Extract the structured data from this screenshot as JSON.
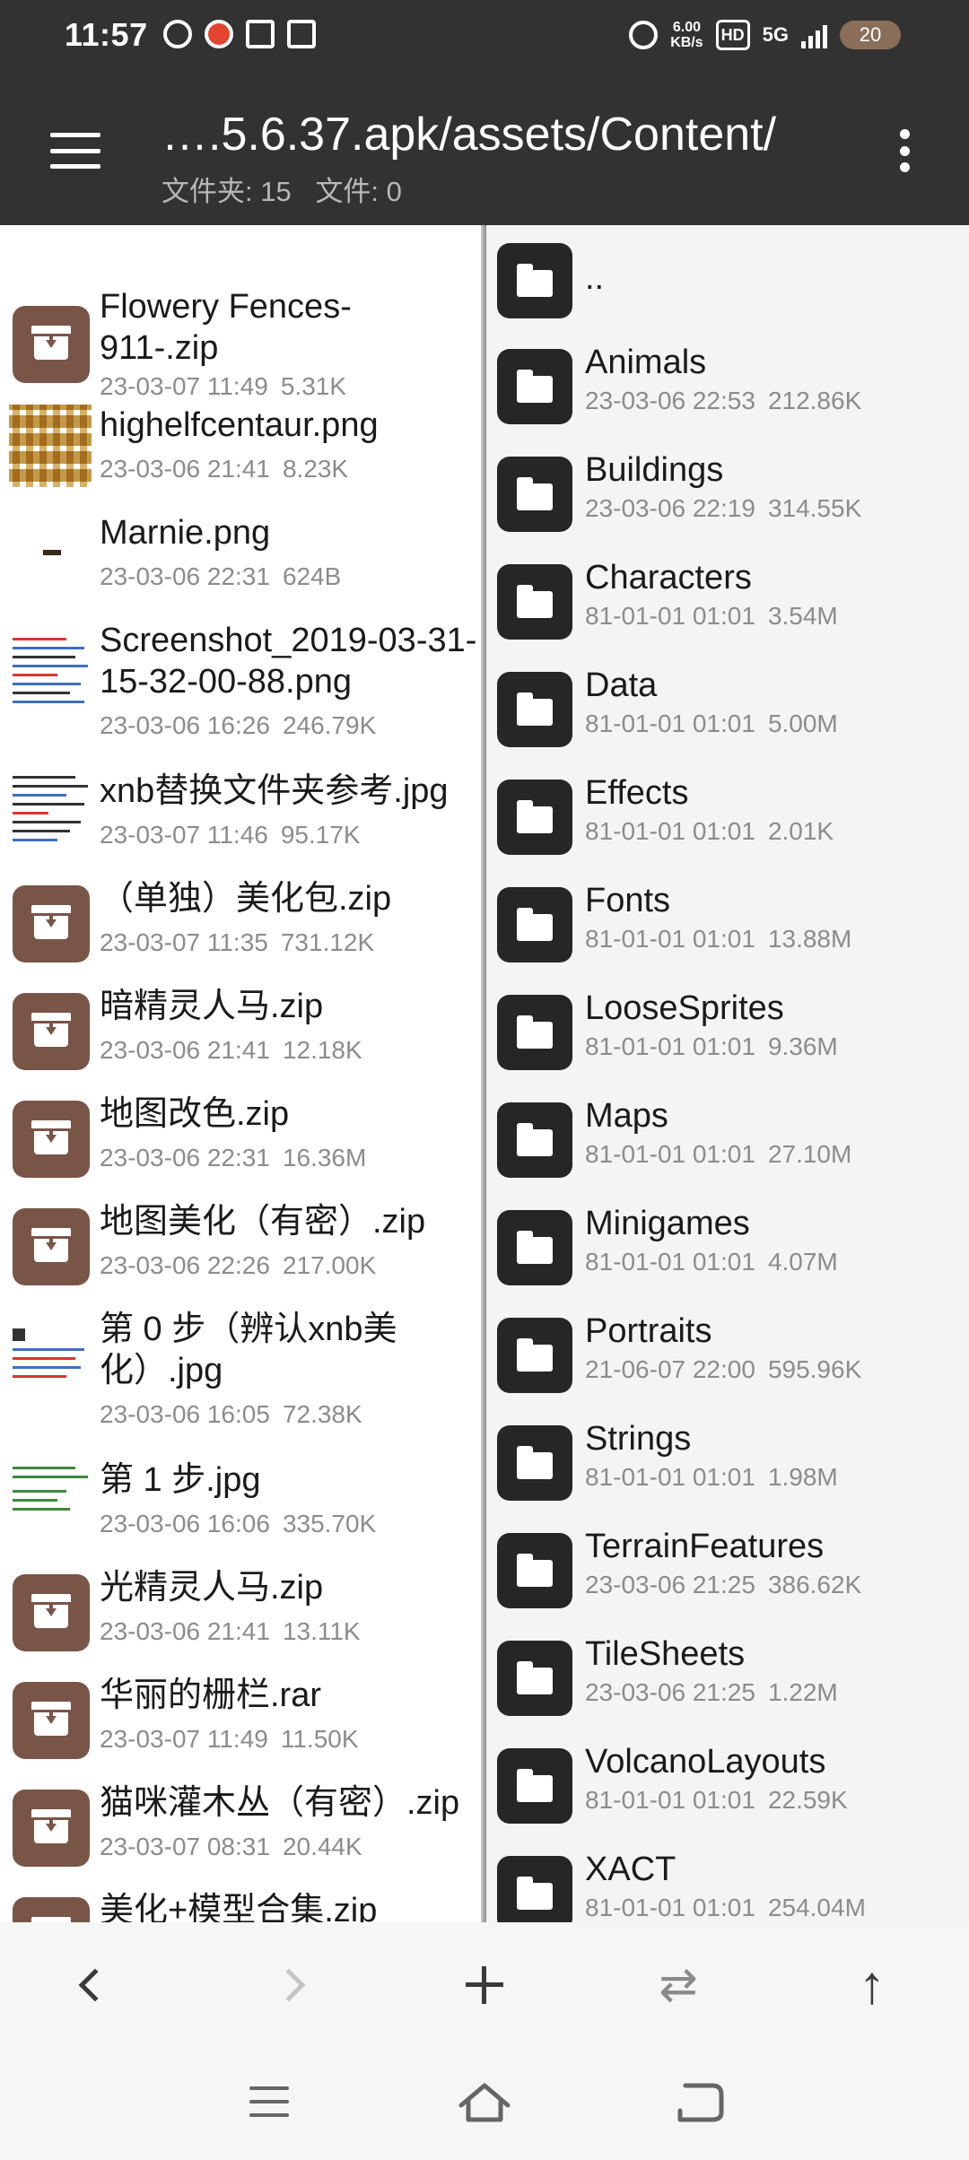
{
  "status_bar": {
    "time": "11:57",
    "net_speed_value": "6.00",
    "net_speed_unit": "KB/s",
    "hd": "HD",
    "signal": "5G",
    "battery": "20"
  },
  "toolbar": {
    "path": "….5.6.37.apk/assets/Content/",
    "folders_count": "文件夹: 15",
    "files_count": "文件: 0"
  },
  "left_pane": {
    "items": [
      {
        "name": "Flowery Fences-911-.zip",
        "date": "23-03-07 11:49",
        "size": "5.31K",
        "icon": "zip-icon"
      },
      {
        "name": "highelfcentaur.png",
        "date": "23-03-06 21:41",
        "size": "8.23K",
        "icon": "image-thumbnail"
      },
      {
        "name": "Marnie.png",
        "date": "23-03-06 22:31",
        "size": "624B",
        "icon": "image-thumbnail"
      },
      {
        "name": "Screenshot_2019-03-31-15-32-00-88.png",
        "date": "23-03-06 16:26",
        "size": "246.79K",
        "icon": "image-thumbnail"
      },
      {
        "name": "xnb替换文件夹参考.jpg",
        "date": "23-03-07 11:46",
        "size": "95.17K",
        "icon": "image-thumbnail"
      },
      {
        "name": "（单独）美化包.zip",
        "date": "23-03-07 11:35",
        "size": "731.12K",
        "icon": "zip-icon"
      },
      {
        "name": "暗精灵人马.zip",
        "date": "23-03-06 21:41",
        "size": "12.18K",
        "icon": "zip-icon"
      },
      {
        "name": "地图改色.zip",
        "date": "23-03-06 22:31",
        "size": "16.36M",
        "icon": "zip-icon"
      },
      {
        "name": "地图美化（有密）.zip",
        "date": "23-03-06 22:26",
        "size": "217.00K",
        "icon": "zip-icon"
      },
      {
        "name": "第 0 步（辨认xnb美化）.jpg",
        "date": "23-03-06 16:05",
        "size": "72.38K",
        "icon": "image-thumbnail"
      },
      {
        "name": "第 1 步.jpg",
        "date": "23-03-06 16:06",
        "size": "335.70K",
        "icon": "image-thumbnail"
      },
      {
        "name": "光精灵人马.zip",
        "date": "23-03-06 21:41",
        "size": "13.11K",
        "icon": "zip-icon"
      },
      {
        "name": "华丽的栅栏.rar",
        "date": "23-03-07 11:49",
        "size": "11.50K",
        "icon": "zip-icon"
      },
      {
        "name": "猫咪灌木丛（有密）.zip",
        "date": "23-03-07 08:31",
        "size": "20.44K",
        "icon": "zip-icon"
      },
      {
        "name": "美化+模型合集.zip",
        "date": "",
        "size": "",
        "icon": "zip-icon"
      }
    ]
  },
  "right_pane": {
    "parent": "..",
    "items": [
      {
        "name": "Animals",
        "date": "23-03-06 22:53",
        "size": "212.86K"
      },
      {
        "name": "Buildings",
        "date": "23-03-06 22:19",
        "size": "314.55K"
      },
      {
        "name": "Characters",
        "date": "81-01-01 01:01",
        "size": "3.54M"
      },
      {
        "name": "Data",
        "date": "81-01-01 01:01",
        "size": "5.00M"
      },
      {
        "name": "Effects",
        "date": "81-01-01 01:01",
        "size": "2.01K"
      },
      {
        "name": "Fonts",
        "date": "81-01-01 01:01",
        "size": "13.88M"
      },
      {
        "name": "LooseSprites",
        "date": "81-01-01 01:01",
        "size": "9.36M"
      },
      {
        "name": "Maps",
        "date": "81-01-01 01:01",
        "size": "27.10M"
      },
      {
        "name": "Minigames",
        "date": "81-01-01 01:01",
        "size": "4.07M"
      },
      {
        "name": "Portraits",
        "date": "21-06-07 22:00",
        "size": "595.96K"
      },
      {
        "name": "Strings",
        "date": "81-01-01 01:01",
        "size": "1.98M"
      },
      {
        "name": "TerrainFeatures",
        "date": "23-03-06 21:25",
        "size": "386.62K"
      },
      {
        "name": "TileSheets",
        "date": "23-03-06 21:25",
        "size": "1.22M"
      },
      {
        "name": "VolcanoLayouts",
        "date": "81-01-01 01:01",
        "size": "22.59K"
      },
      {
        "name": "XACT",
        "date": "81-01-01 01:01",
        "size": "254.04M"
      }
    ]
  },
  "bottom_toolbar": {
    "back": "chevron-left-icon",
    "forward": "chevron-right-icon",
    "add": "plus-icon",
    "swap": "swap-icon",
    "up": "arrow-up-icon"
  },
  "colors": {
    "toolbar_bg": "#323232",
    "zip_icon_bg": "#795548",
    "folder_icon_bg": "#262626",
    "meta_text": "#8c8c8c"
  }
}
